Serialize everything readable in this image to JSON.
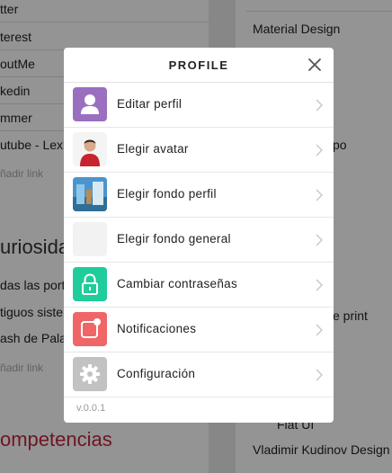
{
  "background": {
    "left_items": [
      "tter",
      "terest",
      "outMe",
      "kedin",
      "mmer",
      "utube - Lexl"
    ],
    "left_add_link_1": "ñadir link",
    "left_heading_1": "uriosida",
    "left_items_2": [
      "das las port",
      "tiguos siste",
      "ash de Pala"
    ],
    "left_add_link_2": "ñadir link",
    "left_heading_2": "ompetencias",
    "right_items": [
      "Material Design",
      "po",
      "e print",
      "Flat UI",
      "Vladimir Kudinov Design"
    ]
  },
  "modal": {
    "title": "PROFILE",
    "version": "v.0.0.1",
    "items": [
      {
        "label": "Editar perfil",
        "icon": "user-icon",
        "color": "#9a6fc0"
      },
      {
        "label": "Elegir avatar",
        "icon": "avatar-photo",
        "color": "#ffffff"
      },
      {
        "label": "Elegir fondo perfil",
        "icon": "background-photo",
        "color": "#3b7fb8"
      },
      {
        "label": "Elegir fondo general",
        "icon": "blank-thumbnail",
        "color": "#f2f2f2"
      },
      {
        "label": "Cambiar contraseñas",
        "icon": "lock-icon",
        "color": "#1fcc9c"
      },
      {
        "label": "Notificaciones",
        "icon": "notification-icon",
        "color": "#f06566"
      },
      {
        "label": "Configuración",
        "icon": "gear-icon",
        "color": "#c2c2c2"
      }
    ]
  }
}
